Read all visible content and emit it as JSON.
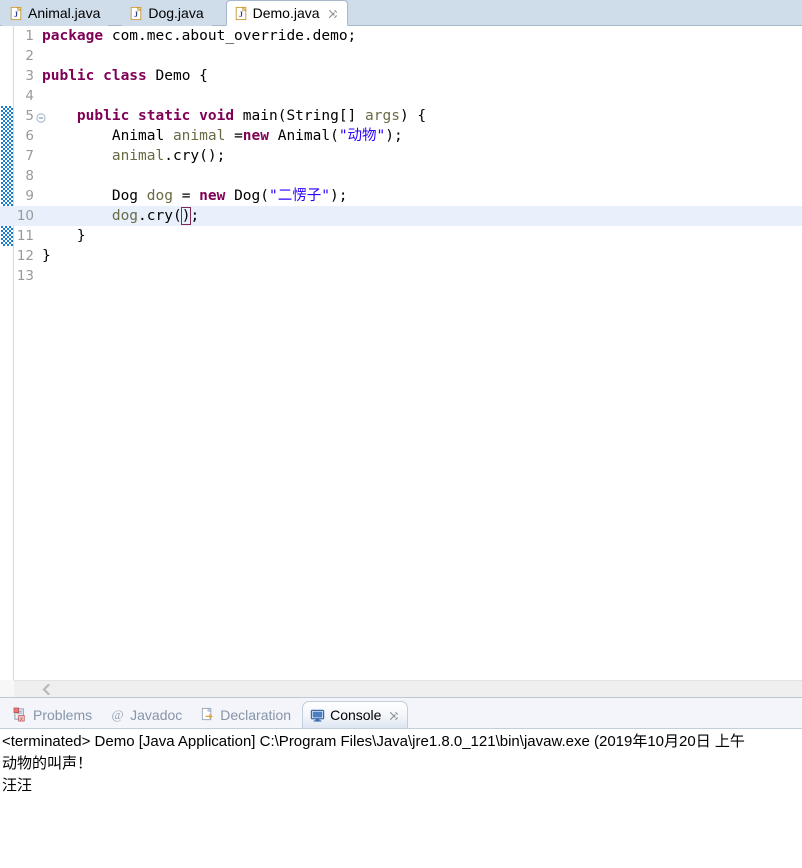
{
  "editor": {
    "tabs": [
      {
        "label": "Animal.java",
        "icon": "java-file-icon",
        "active": false,
        "closable": false
      },
      {
        "label": "Dog.java",
        "icon": "java-file-icon",
        "active": false,
        "closable": false
      },
      {
        "label": "Demo.java",
        "icon": "java-file-icon",
        "active": true,
        "closable": true
      }
    ],
    "scrollbar": {
      "left_arrow_icon": "chevron-left-icon"
    },
    "lines": [
      {
        "number": "1",
        "fold": "",
        "current": false,
        "tokens": [
          {
            "t": "package ",
            "c": "kw"
          },
          {
            "t": "com.mec.about_override.demo;",
            "c": "plain"
          }
        ]
      },
      {
        "number": "2",
        "fold": "",
        "current": false,
        "tokens": []
      },
      {
        "number": "3",
        "fold": "",
        "current": false,
        "tokens": [
          {
            "t": "public class ",
            "c": "kw"
          },
          {
            "t": "Demo {",
            "c": "plain"
          }
        ]
      },
      {
        "number": "4",
        "fold": "",
        "current": false,
        "tokens": []
      },
      {
        "number": "5",
        "fold": "collapse-icon",
        "current": false,
        "tokens": [
          {
            "t": "    ",
            "c": "plain"
          },
          {
            "t": "public static void ",
            "c": "kw"
          },
          {
            "t": "main(String[] ",
            "c": "plain"
          },
          {
            "t": "args",
            "c": "var"
          },
          {
            "t": ") {",
            "c": "plain"
          }
        ]
      },
      {
        "number": "6",
        "fold": "",
        "current": false,
        "tokens": [
          {
            "t": "        Animal ",
            "c": "plain"
          },
          {
            "t": "animal ",
            "c": "var"
          },
          {
            "t": "=",
            "c": "plain"
          },
          {
            "t": "new ",
            "c": "kw"
          },
          {
            "t": "Animal(",
            "c": "plain"
          },
          {
            "t": "\"动物\"",
            "c": "str"
          },
          {
            "t": ");",
            "c": "plain"
          }
        ]
      },
      {
        "number": "7",
        "fold": "",
        "current": false,
        "tokens": [
          {
            "t": "        ",
            "c": "plain"
          },
          {
            "t": "animal",
            "c": "var"
          },
          {
            "t": ".cry();",
            "c": "plain"
          }
        ]
      },
      {
        "number": "8",
        "fold": "",
        "current": false,
        "tokens": []
      },
      {
        "number": "9",
        "fold": "",
        "current": false,
        "tokens": [
          {
            "t": "        Dog ",
            "c": "plain"
          },
          {
            "t": "dog ",
            "c": "var"
          },
          {
            "t": "= ",
            "c": "plain"
          },
          {
            "t": "new ",
            "c": "kw"
          },
          {
            "t": "Dog(",
            "c": "plain"
          },
          {
            "t": "\"二愣子\"",
            "c": "str"
          },
          {
            "t": ");",
            "c": "plain"
          }
        ]
      },
      {
        "number": "10",
        "fold": "",
        "current": true,
        "tokens": [
          {
            "t": "        ",
            "c": "plain"
          },
          {
            "t": "dog",
            "c": "var"
          },
          {
            "t": ".cry(",
            "c": "plain"
          },
          {
            "t": ")",
            "c": "plain",
            "bracket": true
          },
          {
            "t": ";",
            "c": "plain"
          }
        ]
      },
      {
        "number": "11",
        "fold": "",
        "current": false,
        "tokens": [
          {
            "t": "    }",
            "c": "plain"
          }
        ]
      },
      {
        "number": "12",
        "fold": "",
        "current": false,
        "tokens": [
          {
            "t": "}",
            "c": "plain"
          }
        ]
      },
      {
        "number": "13",
        "fold": "",
        "current": false,
        "tokens": []
      }
    ]
  },
  "bottom_panel": {
    "tabs": [
      {
        "label": "Problems",
        "icon": "problems-icon",
        "active": false,
        "closable": false
      },
      {
        "label": "Javadoc",
        "icon": "javadoc-icon",
        "active": false,
        "closable": false
      },
      {
        "label": "Declaration",
        "icon": "declaration-icon",
        "active": false,
        "closable": false
      },
      {
        "label": "Console",
        "icon": "console-icon",
        "active": true,
        "closable": true
      }
    ],
    "console_lines": [
      "<terminated> Demo [Java Application] C:\\Program Files\\Java\\jre1.8.0_121\\bin\\javaw.exe (2019年10月20日 上午",
      "动物的叫声！",
      "汪汪"
    ]
  },
  "colors": {
    "tab_strip_bg": "#cfdcea",
    "active_tab_bg": "#ffffff",
    "keyword": "#7f0055",
    "string": "#2a00ff",
    "local_var": "#6a6a46",
    "current_line": "#e8f0fb",
    "change_bar": "#1a7fd4",
    "line_number": "#999999",
    "panel_bg": "#f3f5fa"
  }
}
